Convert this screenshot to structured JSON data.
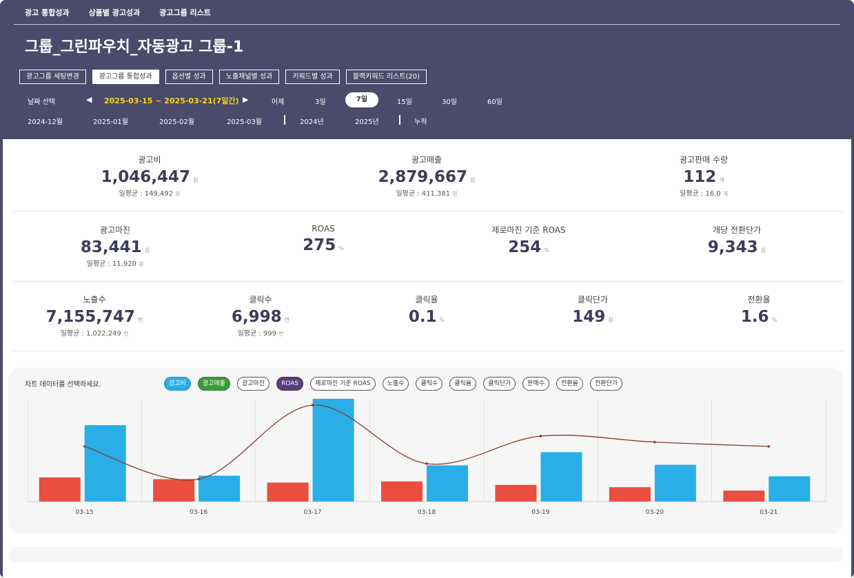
{
  "nav": {
    "items": [
      "광고 통합성과",
      "상품별 광고성과",
      "광고그룹 리스트"
    ]
  },
  "title": "그룹_그린파우치_자동광고 그룹-1",
  "tabs": [
    {
      "label": "광고그룹 세팅변경",
      "active": false
    },
    {
      "label": "광고그룹 통합성과",
      "active": true
    },
    {
      "label": "옵션별 성과",
      "active": false
    },
    {
      "label": "노출채널별 성과",
      "active": false
    },
    {
      "label": "키워드별 성과",
      "active": false
    },
    {
      "label": "블랙키워드 리스트(20)",
      "active": false
    }
  ],
  "date": {
    "label": "날짜 선택",
    "prev": "◀",
    "range": "2025-03-15 ~ 2025-03-21(7일간)",
    "next": "▶",
    "options": [
      "어제",
      "3일",
      "7일",
      "15일",
      "30일",
      "60일"
    ],
    "selected": "7일",
    "months": [
      "2024-12월",
      "2025-01월",
      "2025-02월",
      "2025-03월"
    ],
    "years": [
      "2024년",
      "2025년"
    ],
    "cumulative": "누적"
  },
  "metrics": {
    "ad_cost": {
      "label": "광고비",
      "value": "1,046,447",
      "unit": "원",
      "avg": "일평균 : 149,492",
      "avg_unit": "원"
    },
    "ad_revenue": {
      "label": "광고매출",
      "value": "2,879,667",
      "unit": "원",
      "avg": "일평균 : 411,381",
      "avg_unit": "원"
    },
    "ad_sales_qty": {
      "label": "광고판매 수량",
      "value": "112",
      "unit": "개",
      "avg": "일평균 : 16.0",
      "avg_unit": "개"
    },
    "ad_margin": {
      "label": "광고마진",
      "value": "83,441",
      "unit": "원",
      "avg": "일평균 : 11,920",
      "avg_unit": "원"
    },
    "roas": {
      "label": "ROAS",
      "value": "275",
      "unit": "%"
    },
    "zero_margin_roas": {
      "label": "제로마진 기준 ROAS",
      "value": "254",
      "unit": "%"
    },
    "cost_per_conversion": {
      "label": "개당 전환단가",
      "value": "9,343",
      "unit": "원"
    },
    "impressions": {
      "label": "노출수",
      "value": "7,155,747",
      "unit": "번",
      "avg": "일평균 : 1,022,249",
      "avg_unit": "번"
    },
    "clicks": {
      "label": "클릭수",
      "value": "6,998",
      "unit": "번",
      "avg": "일평균 : 999",
      "avg_unit": "번"
    },
    "ctr": {
      "label": "클릭율",
      "value": "0.1",
      "unit": "%"
    },
    "cpc": {
      "label": "클릭단가",
      "value": "149",
      "unit": "원"
    },
    "conversion_rate": {
      "label": "전환율",
      "value": "1.6",
      "unit": "%"
    }
  },
  "chart": {
    "hint": "차트 데이터를 선택하세요.",
    "chips": [
      {
        "label": "광고비",
        "style": "blue"
      },
      {
        "label": "광고매출",
        "style": "green"
      },
      {
        "label": "광고마진",
        "style": ""
      },
      {
        "label": "ROAS",
        "style": "purple"
      },
      {
        "label": "제로마진 기준 ROAS",
        "style": ""
      },
      {
        "label": "노출수",
        "style": ""
      },
      {
        "label": "클릭수",
        "style": ""
      },
      {
        "label": "클릭율",
        "style": ""
      },
      {
        "label": "클릭단가",
        "style": ""
      },
      {
        "label": "판매수",
        "style": ""
      },
      {
        "label": "전환율",
        "style": ""
      },
      {
        "label": "전환단가",
        "style": ""
      }
    ]
  },
  "chart_data": {
    "type": "bar",
    "categories": [
      "03-15",
      "03-16",
      "03-17",
      "03-18",
      "03-19",
      "03-20",
      "03-21"
    ],
    "series": [
      {
        "name": "광고비",
        "type": "bar",
        "color": "#e94e3f",
        "values": [
          210000,
          195000,
          165000,
          175000,
          145000,
          125000,
          95000
        ]
      },
      {
        "name": "광고매출",
        "type": "bar",
        "color": "#29aee8",
        "values": [
          665000,
          225000,
          895000,
          315000,
          430000,
          320000,
          220000
        ]
      },
      {
        "name": "ROAS",
        "type": "line",
        "color": "#8b3a2a",
        "values": [
          320,
          130,
          560,
          220,
          380,
          345,
          320
        ]
      }
    ],
    "ylim_bars": [
      0,
      900000
    ],
    "ylim_line": [
      0,
      600
    ],
    "grid": true,
    "legend": "none"
  }
}
